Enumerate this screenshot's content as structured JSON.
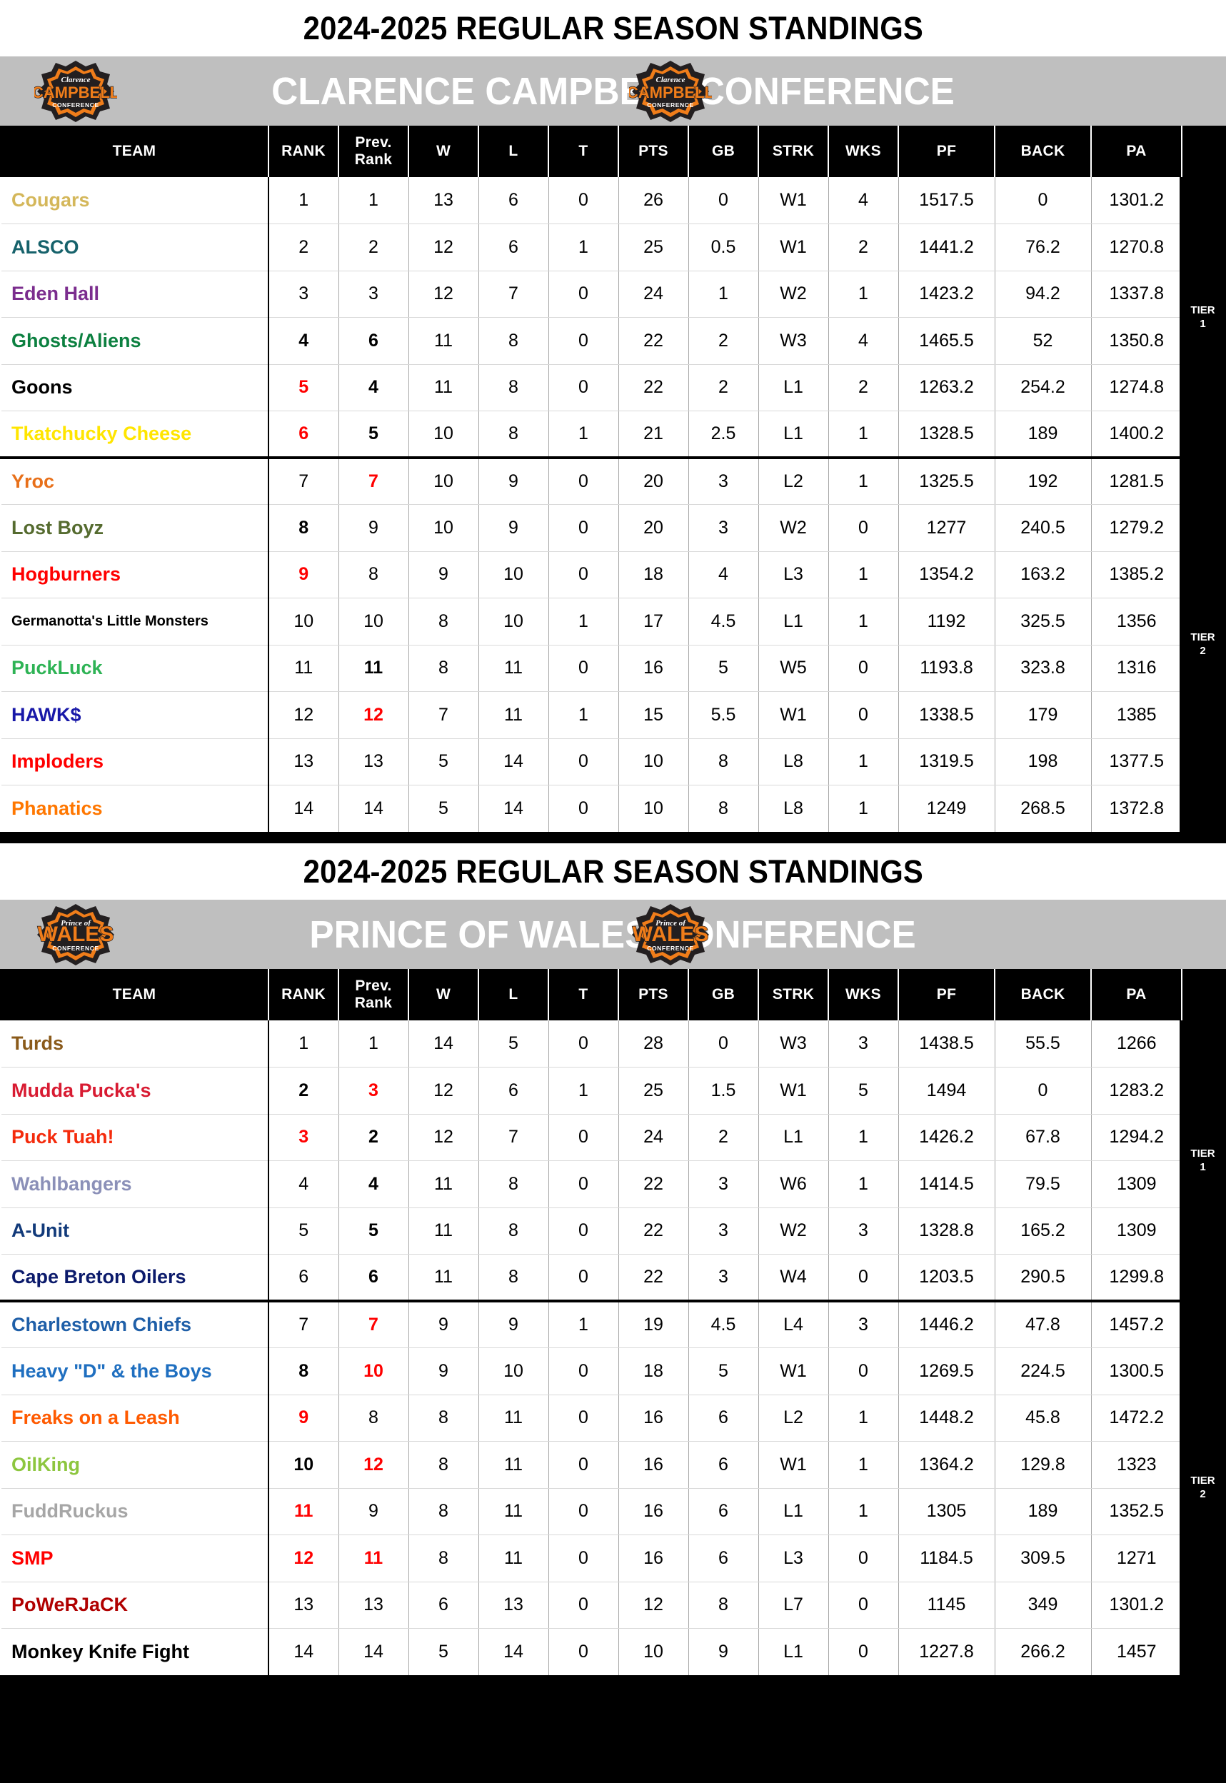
{
  "season_title": "2024-2025 REGULAR SEASON STANDINGS",
  "columns": [
    "TEAM",
    "RANK",
    "Prev. Rank",
    "W",
    "L",
    "T",
    "PTS",
    "GB",
    "STRK",
    "WKS",
    "PF",
    "BACK",
    "PA"
  ],
  "column_head_labels": {
    "team": "TEAM",
    "rank": "RANK",
    "prev_rank_line1": "Prev.",
    "prev_rank_line2": "Rank",
    "w": "W",
    "l": "L",
    "t": "T",
    "pts": "PTS",
    "gb": "GB",
    "strk": "STRK",
    "wks": "WKS",
    "pf": "PF",
    "back": "BACK",
    "pa": "PA"
  },
  "tier_labels": {
    "tier1_line1": "TIER",
    "tier1_line2": "1",
    "tier2_line1": "TIER",
    "tier2_line2": "2"
  },
  "colors": {
    "banner_bg": "#bfbfbf",
    "header_bg": "#000000",
    "highlight_red": "#ff0000",
    "logo_orange": "#f07d1a",
    "logo_dark": "#231f20"
  },
  "conferences": [
    {
      "id": "clarence-campbell",
      "name": "CLARENCE CAMPBELL CONFERENCE",
      "logo_icon": "clarence-campbell-conference-logo",
      "logo_text_top": "Clarence",
      "logo_text_main": "CAMPBELL",
      "logo_text_bottom": "CONFERENCE",
      "tier_break_after_row": 6,
      "rows": [
        {
          "team": "Cougars",
          "color": "#d4b75a",
          "bold_team": true,
          "rank": "1",
          "rank_red": false,
          "rank_bold": false,
          "prev": "1",
          "prev_red": false,
          "prev_bold": false,
          "w": "13",
          "l": "6",
          "t": "0",
          "pts": "26",
          "gb": "0",
          "strk": "W1",
          "wks": "4",
          "pf": "1517.5",
          "back": "0",
          "pa": "1301.2"
        },
        {
          "team": "ALSCO",
          "color": "#16626b",
          "bold_team": true,
          "rank": "2",
          "rank_red": false,
          "rank_bold": false,
          "prev": "2",
          "prev_red": false,
          "prev_bold": false,
          "w": "12",
          "l": "6",
          "t": "1",
          "pts": "25",
          "gb": "0.5",
          "strk": "W1",
          "wks": "2",
          "pf": "1441.2",
          "back": "76.2",
          "pa": "1270.8"
        },
        {
          "team": "Eden Hall",
          "color": "#7b2d8e",
          "bold_team": true,
          "rank": "3",
          "rank_red": false,
          "rank_bold": false,
          "prev": "3",
          "prev_red": false,
          "prev_bold": false,
          "w": "12",
          "l": "7",
          "t": "0",
          "pts": "24",
          "gb": "1",
          "strk": "W2",
          "wks": "1",
          "pf": "1423.2",
          "back": "94.2",
          "pa": "1337.8"
        },
        {
          "team": "Ghosts/Aliens",
          "color": "#0c8040",
          "bold_team": true,
          "rank": "4",
          "rank_red": false,
          "rank_bold": true,
          "prev": "6",
          "prev_red": false,
          "prev_bold": true,
          "w": "11",
          "l": "8",
          "t": "0",
          "pts": "22",
          "gb": "2",
          "strk": "W3",
          "wks": "4",
          "pf": "1465.5",
          "back": "52",
          "pa": "1350.8"
        },
        {
          "team": "Goons",
          "color": "#000000",
          "bold_team": true,
          "rank": "5",
          "rank_red": true,
          "rank_bold": true,
          "prev": "4",
          "prev_red": false,
          "prev_bold": true,
          "w": "11",
          "l": "8",
          "t": "0",
          "pts": "22",
          "gb": "2",
          "strk": "L1",
          "wks": "2",
          "pf": "1263.2",
          "back": "254.2",
          "pa": "1274.8"
        },
        {
          "team": "Tkatchucky Cheese",
          "color": "#ffe500",
          "bold_team": true,
          "rank": "6",
          "rank_red": true,
          "rank_bold": true,
          "prev": "5",
          "prev_red": false,
          "prev_bold": true,
          "w": "10",
          "l": "8",
          "t": "1",
          "pts": "21",
          "gb": "2.5",
          "strk": "L1",
          "wks": "1",
          "pf": "1328.5",
          "back": "189",
          "pa": "1400.2"
        },
        {
          "team": "Yroc",
          "color": "#e8701a",
          "bold_team": true,
          "rank": "7",
          "rank_red": false,
          "rank_bold": false,
          "prev": "7",
          "prev_red": true,
          "prev_bold": true,
          "w": "10",
          "l": "9",
          "t": "0",
          "pts": "20",
          "gb": "3",
          "strk": "L2",
          "wks": "1",
          "pf": "1325.5",
          "back": "192",
          "pa": "1281.5"
        },
        {
          "team": "Lost Boyz",
          "color": "#556b2f",
          "bold_team": true,
          "rank": "8",
          "rank_red": false,
          "rank_bold": true,
          "prev": "9",
          "prev_red": false,
          "prev_bold": false,
          "w": "10",
          "l": "9",
          "t": "0",
          "pts": "20",
          "gb": "3",
          "strk": "W2",
          "wks": "0",
          "pf": "1277",
          "back": "240.5",
          "pa": "1279.2"
        },
        {
          "team": "Hogburners",
          "color": "#ff0000",
          "bold_team": true,
          "rank": "9",
          "rank_red": true,
          "rank_bold": true,
          "prev": "8",
          "prev_red": false,
          "prev_bold": false,
          "w": "9",
          "l": "10",
          "t": "0",
          "pts": "18",
          "gb": "4",
          "strk": "L3",
          "wks": "1",
          "pf": "1354.2",
          "back": "163.2",
          "pa": "1385.2"
        },
        {
          "team": "Germanotta's Little Monsters",
          "color": "#000000",
          "bold_team": true,
          "small": true,
          "rank": "10",
          "rank_red": false,
          "rank_bold": false,
          "prev": "10",
          "prev_red": false,
          "prev_bold": false,
          "w": "8",
          "l": "10",
          "t": "1",
          "pts": "17",
          "gb": "4.5",
          "strk": "L1",
          "wks": "1",
          "pf": "1192",
          "back": "325.5",
          "pa": "1356"
        },
        {
          "team": "PuckLuck",
          "color": "#2eb355",
          "bold_team": true,
          "rank": "11",
          "rank_red": false,
          "rank_bold": false,
          "prev": "11",
          "prev_red": false,
          "prev_bold": true,
          "w": "8",
          "l": "11",
          "t": "0",
          "pts": "16",
          "gb": "5",
          "strk": "W5",
          "wks": "0",
          "pf": "1193.8",
          "back": "323.8",
          "pa": "1316"
        },
        {
          "team": "HAWK$",
          "color": "#1818a8",
          "bold_team": true,
          "rank": "12",
          "rank_red": false,
          "rank_bold": false,
          "prev": "12",
          "prev_red": true,
          "prev_bold": true,
          "w": "7",
          "l": "11",
          "t": "1",
          "pts": "15",
          "gb": "5.5",
          "strk": "W1",
          "wks": "0",
          "pf": "1338.5",
          "back": "179",
          "pa": "1385"
        },
        {
          "team": "Imploders",
          "color": "#ff0000",
          "bold_team": true,
          "rank": "13",
          "rank_red": false,
          "rank_bold": false,
          "prev": "13",
          "prev_red": false,
          "prev_bold": false,
          "w": "5",
          "l": "14",
          "t": "0",
          "pts": "10",
          "gb": "8",
          "strk": "L8",
          "wks": "1",
          "pf": "1319.5",
          "back": "198",
          "pa": "1377.5"
        },
        {
          "team": "Phanatics",
          "color": "#ff7700",
          "bold_team": true,
          "rank": "14",
          "rank_red": false,
          "rank_bold": false,
          "prev": "14",
          "prev_red": false,
          "prev_bold": false,
          "w": "5",
          "l": "14",
          "t": "0",
          "pts": "10",
          "gb": "8",
          "strk": "L8",
          "wks": "1",
          "pf": "1249",
          "back": "268.5",
          "pa": "1372.8"
        }
      ]
    },
    {
      "id": "prince-of-wales",
      "name": "PRINCE OF WALES CONFERENCE",
      "logo_icon": "prince-of-wales-conference-logo",
      "logo_text_top": "Prince of",
      "logo_text_main": "WALES",
      "logo_text_bottom": "CONFERENCE",
      "tier_break_after_row": 6,
      "rows": [
        {
          "team": "Turds",
          "color": "#8a5a1a",
          "bold_team": true,
          "rank": "1",
          "rank_red": false,
          "rank_bold": false,
          "prev": "1",
          "prev_red": false,
          "prev_bold": false,
          "w": "14",
          "l": "5",
          "t": "0",
          "pts": "28",
          "gb": "0",
          "strk": "W3",
          "wks": "3",
          "pf": "1438.5",
          "back": "55.5",
          "pa": "1266"
        },
        {
          "team": "Mudda Pucka's",
          "color": "#d81b32",
          "bold_team": true,
          "rank": "2",
          "rank_red": false,
          "rank_bold": true,
          "prev": "3",
          "prev_red": true,
          "prev_bold": true,
          "w": "12",
          "l": "6",
          "t": "1",
          "pts": "25",
          "gb": "1.5",
          "strk": "W1",
          "wks": "5",
          "pf": "1494",
          "back": "0",
          "pa": "1283.2"
        },
        {
          "team": "Puck Tuah!",
          "color": "#f42b0c",
          "bold_team": true,
          "rank": "3",
          "rank_red": true,
          "rank_bold": true,
          "prev": "2",
          "prev_red": false,
          "prev_bold": true,
          "w": "12",
          "l": "7",
          "t": "0",
          "pts": "24",
          "gb": "2",
          "strk": "L1",
          "wks": "1",
          "pf": "1426.2",
          "back": "67.8",
          "pa": "1294.2"
        },
        {
          "team": "Wahlbangers",
          "color": "#8b90b8",
          "bold_team": true,
          "rank": "4",
          "rank_red": false,
          "rank_bold": false,
          "prev": "4",
          "prev_red": false,
          "prev_bold": true,
          "w": "11",
          "l": "8",
          "t": "0",
          "pts": "22",
          "gb": "3",
          "strk": "W6",
          "wks": "1",
          "pf": "1414.5",
          "back": "79.5",
          "pa": "1309"
        },
        {
          "team": "A-Unit",
          "color": "#123a7a",
          "bold_team": true,
          "rank": "5",
          "rank_red": false,
          "rank_bold": false,
          "prev": "5",
          "prev_red": false,
          "prev_bold": true,
          "w": "11",
          "l": "8",
          "t": "0",
          "pts": "22",
          "gb": "3",
          "strk": "W2",
          "wks": "3",
          "pf": "1328.8",
          "back": "165.2",
          "pa": "1309"
        },
        {
          "team": "Cape Breton Oilers",
          "color": "#0b1a6b",
          "bold_team": true,
          "rank": "6",
          "rank_red": false,
          "rank_bold": false,
          "prev": "6",
          "prev_red": false,
          "prev_bold": true,
          "w": "11",
          "l": "8",
          "t": "0",
          "pts": "22",
          "gb": "3",
          "strk": "W4",
          "wks": "0",
          "pf": "1203.5",
          "back": "290.5",
          "pa": "1299.8"
        },
        {
          "team": "Charlestown Chiefs",
          "color": "#1f5fa8",
          "bold_team": true,
          "rank": "7",
          "rank_red": false,
          "rank_bold": false,
          "prev": "7",
          "prev_red": true,
          "prev_bold": true,
          "w": "9",
          "l": "9",
          "t": "1",
          "pts": "19",
          "gb": "4.5",
          "strk": "L4",
          "wks": "3",
          "pf": "1446.2",
          "back": "47.8",
          "pa": "1457.2"
        },
        {
          "team": "Heavy \"D\" & the Boys",
          "color": "#1f6fc0",
          "bold_team": true,
          "rank": "8",
          "rank_red": false,
          "rank_bold": true,
          "prev": "10",
          "prev_red": true,
          "prev_bold": true,
          "w": "9",
          "l": "10",
          "t": "0",
          "pts": "18",
          "gb": "5",
          "strk": "W1",
          "wks": "0",
          "pf": "1269.5",
          "back": "224.5",
          "pa": "1300.5"
        },
        {
          "team": "Freaks on a Leash",
          "color": "#ff5a00",
          "bold_team": true,
          "rank": "9",
          "rank_red": true,
          "rank_bold": true,
          "prev": "8",
          "prev_red": false,
          "prev_bold": false,
          "w": "8",
          "l": "11",
          "t": "0",
          "pts": "16",
          "gb": "6",
          "strk": "L2",
          "wks": "1",
          "pf": "1448.2",
          "back": "45.8",
          "pa": "1472.2"
        },
        {
          "team": "OilKing",
          "color": "#8dc63f",
          "bold_team": true,
          "rank": "10",
          "rank_red": false,
          "rank_bold": true,
          "prev": "12",
          "prev_red": true,
          "prev_bold": true,
          "w": "8",
          "l": "11",
          "t": "0",
          "pts": "16",
          "gb": "6",
          "strk": "W1",
          "wks": "1",
          "pf": "1364.2",
          "back": "129.8",
          "pa": "1323"
        },
        {
          "team": "FuddRuckus",
          "color": "#a6a6a6",
          "bold_team": true,
          "rank": "11",
          "rank_red": true,
          "rank_bold": true,
          "prev": "9",
          "prev_red": false,
          "prev_bold": false,
          "w": "8",
          "l": "11",
          "t": "0",
          "pts": "16",
          "gb": "6",
          "strk": "L1",
          "wks": "1",
          "pf": "1305",
          "back": "189",
          "pa": "1352.5"
        },
        {
          "team": "SMP",
          "color": "#ff0000",
          "bold_team": true,
          "rank": "12",
          "rank_red": true,
          "rank_bold": true,
          "prev": "11",
          "prev_red": true,
          "prev_bold": true,
          "w": "8",
          "l": "11",
          "t": "0",
          "pts": "16",
          "gb": "6",
          "strk": "L3",
          "wks": "0",
          "pf": "1184.5",
          "back": "309.5",
          "pa": "1271"
        },
        {
          "team": "PoWeRJaCK",
          "color": "#b00000",
          "bold_team": true,
          "rank": "13",
          "rank_red": false,
          "rank_bold": false,
          "prev": "13",
          "prev_red": false,
          "prev_bold": false,
          "w": "6",
          "l": "13",
          "t": "0",
          "pts": "12",
          "gb": "8",
          "strk": "L7",
          "wks": "0",
          "pf": "1145",
          "back": "349",
          "pa": "1301.2"
        },
        {
          "team": "Monkey Knife Fight",
          "color": "#000000",
          "bold_team": true,
          "rank": "14",
          "rank_red": false,
          "rank_bold": false,
          "prev": "14",
          "prev_red": false,
          "prev_bold": false,
          "w": "5",
          "l": "14",
          "t": "0",
          "pts": "10",
          "gb": "9",
          "strk": "L1",
          "wks": "0",
          "pf": "1227.8",
          "back": "266.2",
          "pa": "1457"
        }
      ]
    }
  ]
}
